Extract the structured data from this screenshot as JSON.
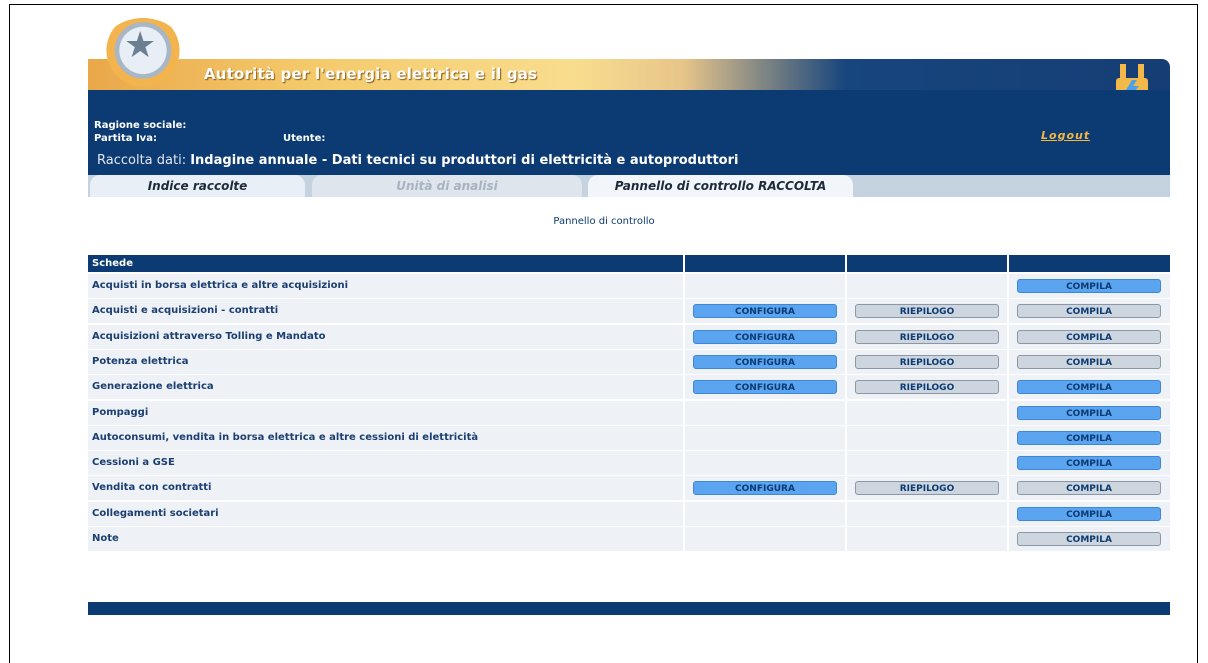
{
  "banner": {
    "title": "Autorità per l'energia elettrica e il gas"
  },
  "header": {
    "logout": "Logout",
    "ragione_sociale": "Ragione sociale:",
    "partita_iva": "Partita Iva:",
    "utente": "Utente:",
    "raccolta_label": "Raccolta dati:",
    "raccolta_value": "Indagine annuale - Dati tecnici su produttori di elettricità e autoproduttori"
  },
  "tabs": [
    {
      "label": "Indice raccolte",
      "state": "available"
    },
    {
      "label": "Unità di analisi",
      "state": "disabled"
    },
    {
      "label": "Pannello di controllo RACCOLTA",
      "state": "active"
    }
  ],
  "panel_title": "Pannello di controllo",
  "table": {
    "header": "Schede",
    "rows": [
      {
        "label": "Acquisti in borsa elettrica e altre acquisizioni",
        "configura": "",
        "riepilogo": "",
        "compila": "COMPILA",
        "compila_style": "blue"
      },
      {
        "label": "Acquisti e acquisizioni - contratti",
        "configura": "CONFIGURA",
        "riepilogo": "RIEPILOGO",
        "compila": "COMPILA",
        "compila_style": "grey"
      },
      {
        "label": "Acquisizioni attraverso Tolling e Mandato",
        "configura": "CONFIGURA",
        "riepilogo": "RIEPILOGO",
        "compila": "COMPILA",
        "compila_style": "grey"
      },
      {
        "label": "Potenza elettrica",
        "configura": "CONFIGURA",
        "riepilogo": "RIEPILOGO",
        "compila": "COMPILA",
        "compila_style": "grey"
      },
      {
        "label": "Generazione elettrica",
        "configura": "CONFIGURA",
        "riepilogo": "RIEPILOGO",
        "compila": "COMPILA",
        "compila_style": "blue"
      },
      {
        "label": "Pompaggi",
        "configura": "",
        "riepilogo": "",
        "compila": "COMPILA",
        "compila_style": "blue"
      },
      {
        "label": "Autoconsumi, vendita in borsa elettrica e altre cessioni di elettricità",
        "configura": "",
        "riepilogo": "",
        "compila": "COMPILA",
        "compila_style": "blue"
      },
      {
        "label": "Cessioni a GSE",
        "configura": "",
        "riepilogo": "",
        "compila": "COMPILA",
        "compila_style": "blue"
      },
      {
        "label": "Vendita con contratti",
        "configura": "CONFIGURA",
        "riepilogo": "RIEPILOGO",
        "compila": "COMPILA",
        "compila_style": "grey"
      },
      {
        "label": "Collegamenti societari",
        "configura": "",
        "riepilogo": "",
        "compila": "COMPILA",
        "compila_style": "blue"
      },
      {
        "label": "Note",
        "configura": "",
        "riepilogo": "",
        "compila": "COMPILA",
        "compila_style": "grey"
      }
    ]
  }
}
